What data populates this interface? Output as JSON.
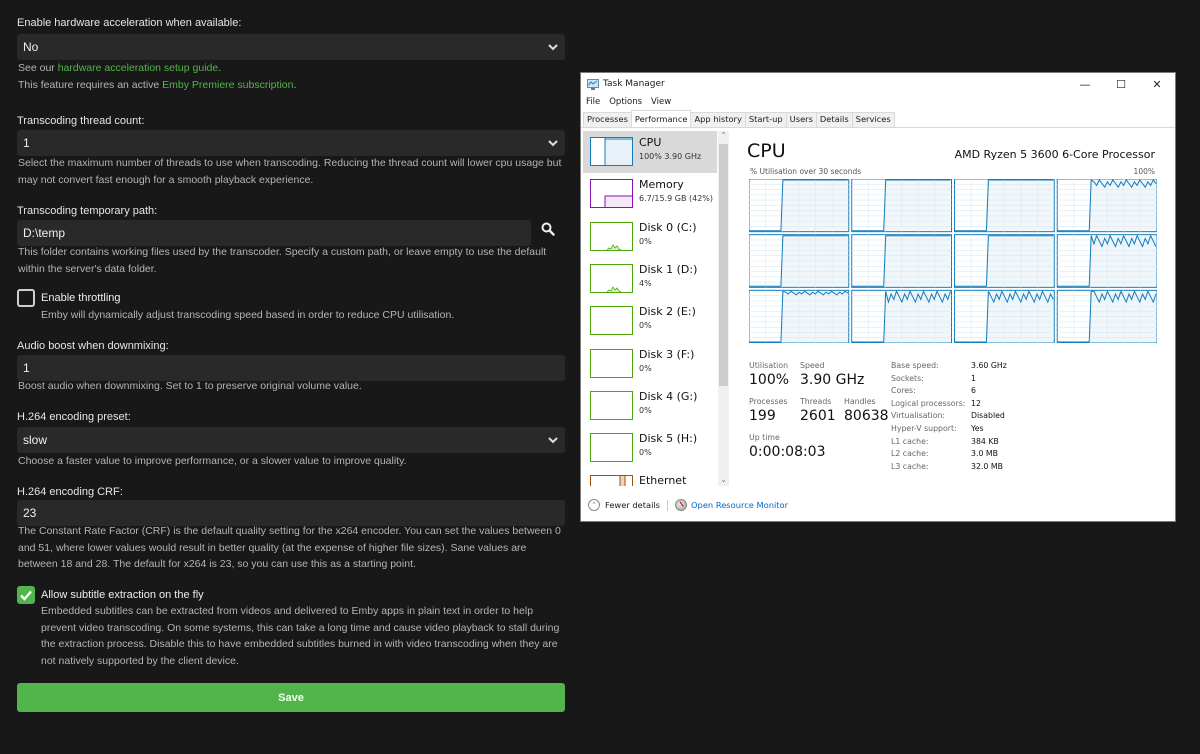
{
  "emby": {
    "hw_accel": {
      "label": "Enable hardware acceleration when available:",
      "value": "No",
      "help_prefix": "See our ",
      "help_link": "hardware acceleration setup guide",
      "help_suffix": ".",
      "premiere_prefix": "This feature requires an active ",
      "premiere_link": "Emby Premiere subscription",
      "premiere_suffix": "."
    },
    "thread_count": {
      "label": "Transcoding thread count:",
      "value": "1",
      "help": "Select the maximum number of threads to use when transcoding. Reducing the thread count will lower cpu usage but may not convert fast enough for a smooth playback experience."
    },
    "temp_path": {
      "label": "Transcoding temporary path:",
      "value": "D:\\temp",
      "help": "This folder contains working files used by the transcoder. Specify a custom path, or leave empty to use the default within the server's data folder.",
      "search_icon": "search-icon"
    },
    "throttling": {
      "label": "Enable throttling",
      "checked": false,
      "help": "Emby will dynamically adjust transcoding speed based in order to reduce CPU utilisation."
    },
    "audio_boost": {
      "label": "Audio boost when downmixing:",
      "value": "1",
      "help": "Boost audio when downmixing. Set to 1 to preserve original volume value."
    },
    "preset": {
      "label": "H.264 encoding preset:",
      "value": "slow",
      "help": "Choose a faster value to improve performance, or a slower value to improve quality."
    },
    "crf": {
      "label": "H.264 encoding CRF:",
      "value": "23",
      "help": "The Constant Rate Factor (CRF) is the default quality setting for the x264 encoder. You can set the values between 0 and 51, where lower values would result in better quality (at the expense of higher file sizes). Sane values are between 18 and 28. The default for x264 is 23, so you can use this as a starting point."
    },
    "subtitle_extraction": {
      "label": "Allow subtitle extraction on the fly",
      "checked": true,
      "help": "Embedded subtitles can be extracted from videos and delivered to Emby apps in plain text in order to help prevent video transcoding. On some systems, this can take a long time and cause video playback to stall during the extraction process. Disable this to have embedded subtitles burned in with video transcoding when they are not natively supported by the client device."
    },
    "save_label": "Save",
    "colors": {
      "accent": "#52b54b",
      "background": "#181818",
      "field": "#292929"
    }
  },
  "taskmanager": {
    "title": "Task Manager",
    "window_controls": {
      "minimize": "—",
      "maximize": "☐",
      "close": "✕"
    },
    "menu": [
      "File",
      "Options",
      "View"
    ],
    "tabs": [
      "Processes",
      "Performance",
      "App history",
      "Start-up",
      "Users",
      "Details",
      "Services"
    ],
    "active_tab": "Performance",
    "sidebar": [
      {
        "name": "CPU",
        "sub": "100% 3.90 GHz",
        "color": "#117dbb",
        "selected": true
      },
      {
        "name": "Memory",
        "sub": "6.7/15.9 GB (42%)",
        "color": "#8b12ae",
        "selected": false
      },
      {
        "name": "Disk 0 (C:)",
        "sub": "0%",
        "color": "#4da60c",
        "selected": false
      },
      {
        "name": "Disk 1 (D:)",
        "sub": "4%",
        "color": "#4da60c",
        "selected": false
      },
      {
        "name": "Disk 2 (E:)",
        "sub": "0%",
        "color": "#4da60c",
        "selected": false
      },
      {
        "name": "Disk 3 (F:)",
        "sub": "0%",
        "color": "#4da60c",
        "selected": false
      },
      {
        "name": "Disk 4 (G:)",
        "sub": "0%",
        "color": "#4da60c",
        "selected": false
      },
      {
        "name": "Disk 5 (H:)",
        "sub": "0%",
        "color": "#4da60c",
        "selected": false
      },
      {
        "name": "Ethernet",
        "sub": "",
        "color": "#a74f01",
        "selected": false
      }
    ],
    "main": {
      "title": "CPU",
      "processor": "AMD Ryzen 5 3600 6-Core Processor",
      "axis_label": "% Utilisation over 30 seconds",
      "axis_max": "100%",
      "logical_processor_count": 12,
      "stats": {
        "utilisation_label": "Utilisation",
        "utilisation": "100%",
        "speed_label": "Speed",
        "speed": "3.90 GHz",
        "processes_label": "Processes",
        "processes": "199",
        "threads_label": "Threads",
        "threads": "2601",
        "handles_label": "Handles",
        "handles": "80638",
        "uptime_label": "Up time",
        "uptime": "0:00:08:03"
      },
      "specs": [
        {
          "k": "Base speed:",
          "v": "3.60 GHz"
        },
        {
          "k": "Sockets:",
          "v": "1"
        },
        {
          "k": "Cores:",
          "v": "6"
        },
        {
          "k": "Logical processors:",
          "v": "12"
        },
        {
          "k": "Virtualisation:",
          "v": "Disabled"
        },
        {
          "k": "Hyper-V support:",
          "v": "Yes"
        },
        {
          "k": "L1 cache:",
          "v": "384 KB"
        },
        {
          "k": "L2 cache:",
          "v": "3.0 MB"
        },
        {
          "k": "L3 cache:",
          "v": "32.0 MB"
        }
      ]
    },
    "footer": {
      "fewer_details": "Fewer details",
      "resource_monitor": "Open Resource Monitor"
    },
    "colors": {
      "cpu_line": "#117dbb",
      "cpu_fill": "#f1f6fa",
      "grid": "#d9eaf4"
    }
  }
}
